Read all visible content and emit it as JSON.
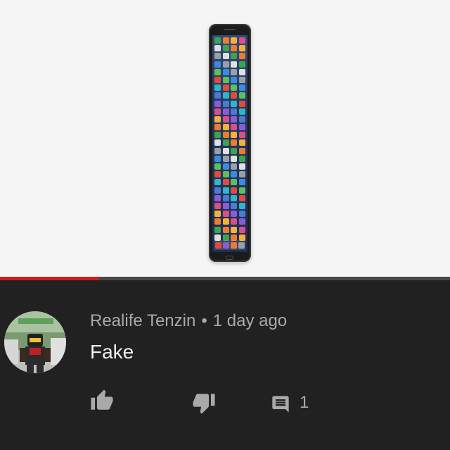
{
  "video": {
    "progress_fraction": 0.22,
    "accent_color": "#cc1d1d",
    "phone_icon_colors": [
      "#3fa34d",
      "#e24b3b",
      "#f2b33a",
      "#3d8be0",
      "#8a5cd6",
      "#e0e0e0",
      "#2fb7c9",
      "#f07a2f",
      "#5bc25b",
      "#d94f8a",
      "#9aa0a6",
      "#4a7bd1"
    ]
  },
  "comment": {
    "author": "Realife Tenzin",
    "separator": "•",
    "timestamp": "1 day ago",
    "text": "Fake",
    "avatar_icon": "roblox-character-avatar",
    "actions": {
      "like_icon": "thumbs-up-icon",
      "dislike_icon": "thumbs-down-icon",
      "reply_icon": "comment-icon",
      "reply_count": "1"
    }
  }
}
